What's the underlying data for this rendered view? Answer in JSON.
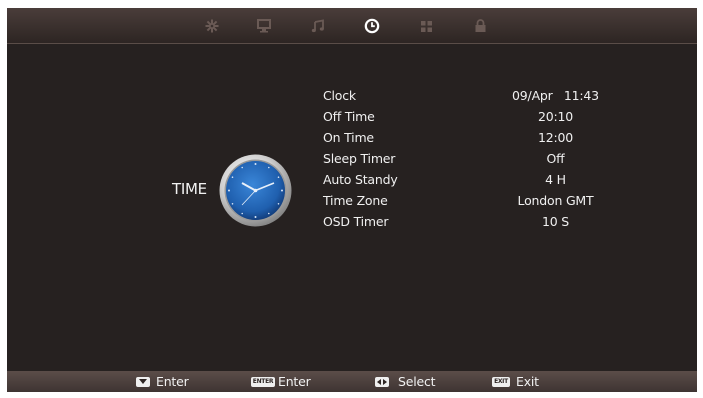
{
  "tabs": [
    {
      "icon": "picture-settings-icon",
      "active": false
    },
    {
      "icon": "screen-icon",
      "active": false
    },
    {
      "icon": "music-note-icon",
      "active": false
    },
    {
      "icon": "clock-icon",
      "active": true
    },
    {
      "icon": "apps-grid-icon",
      "active": false
    },
    {
      "icon": "lock-icon",
      "active": false
    }
  ],
  "section": {
    "title": "TIME",
    "icon": "analog-clock-icon"
  },
  "menu": [
    {
      "label": "Clock",
      "value": "09/Apr   11:43"
    },
    {
      "label": "Off Time",
      "value": "20:10"
    },
    {
      "label": "On Time",
      "value": "12:00"
    },
    {
      "label": "Sleep Timer",
      "value": "Off"
    },
    {
      "label": "Auto Standy",
      "value": "4 H"
    },
    {
      "label": "Time Zone",
      "value": "London GMT"
    },
    {
      "label": "OSD Timer",
      "value": "10 S"
    }
  ],
  "footer": [
    {
      "key": "down-arrow-key-icon",
      "key_text": "",
      "label": "Enter"
    },
    {
      "key": "enter-key-icon",
      "key_text": "ENTER",
      "label": "Enter"
    },
    {
      "key": "left-right-key-icon",
      "key_text": "",
      "label": "Select"
    },
    {
      "key": "exit-key-icon",
      "key_text": "EXIT",
      "label": "Exit"
    }
  ],
  "colors": {
    "background": "#262120",
    "bar": "#4a3d3a",
    "text": "#f0f0f0",
    "inactive_icon": "#6a5a55",
    "active_icon": "#ffffff",
    "clock_face": "#1f5fae"
  }
}
